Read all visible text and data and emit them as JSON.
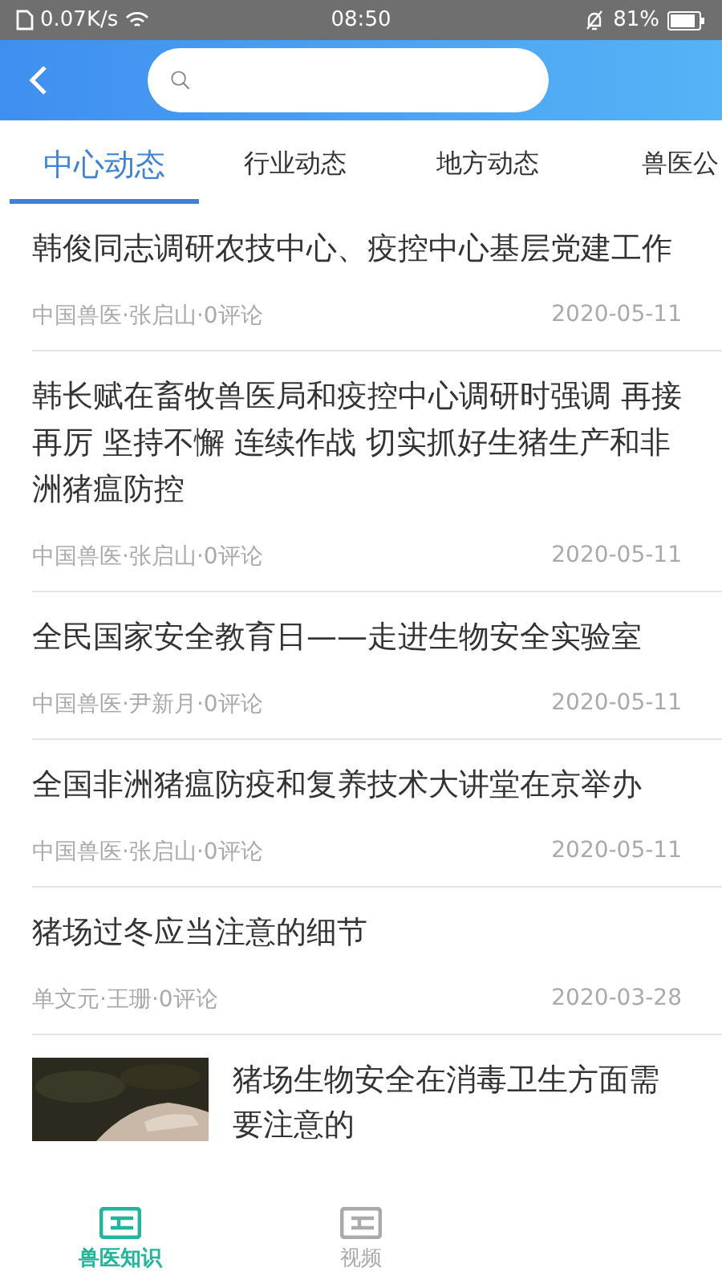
{
  "status_bar": {
    "speed": "0.07K/s",
    "time": "08:50",
    "battery": "81%"
  },
  "tabs": [
    {
      "label": "中心动态",
      "selected": true
    },
    {
      "label": "行业动态",
      "selected": false
    },
    {
      "label": "地方动态",
      "selected": false
    },
    {
      "label": "兽医公",
      "selected": false
    }
  ],
  "articles": [
    {
      "kind": "text",
      "title": "韩俊同志调研农技中心、疫控中心基层党建工作",
      "meta": "中国兽医·张启山·0评论",
      "date": "2020-05-11"
    },
    {
      "kind": "text",
      "title": "韩长赋在畜牧兽医局和疫控中心调研时强调 再接再厉 坚持不懈 连续作战 切实抓好生猪生产和非洲猪瘟防控",
      "meta": "中国兽医·张启山·0评论",
      "date": "2020-05-11"
    },
    {
      "kind": "text",
      "title": "全民国家安全教育日——走进生物安全实验室",
      "meta": "中国兽医·尹新月·0评论",
      "date": "2020-05-11"
    },
    {
      "kind": "text",
      "title": "全国非洲猪瘟防疫和复养技术大讲堂在京举办",
      "meta": "中国兽医·张启山·0评论",
      "date": "2020-05-11"
    },
    {
      "kind": "text",
      "title": "猪场过冬应当注意的细节",
      "meta": "单文元·王珊·0评论",
      "date": "2020-03-28"
    },
    {
      "kind": "picture",
      "title": "猪场生物安全在消毒卫生方面需要注意的"
    }
  ],
  "bottom_nav": [
    {
      "label": "兽医知识",
      "selected": true
    },
    {
      "label": "视频",
      "selected": false
    }
  ]
}
